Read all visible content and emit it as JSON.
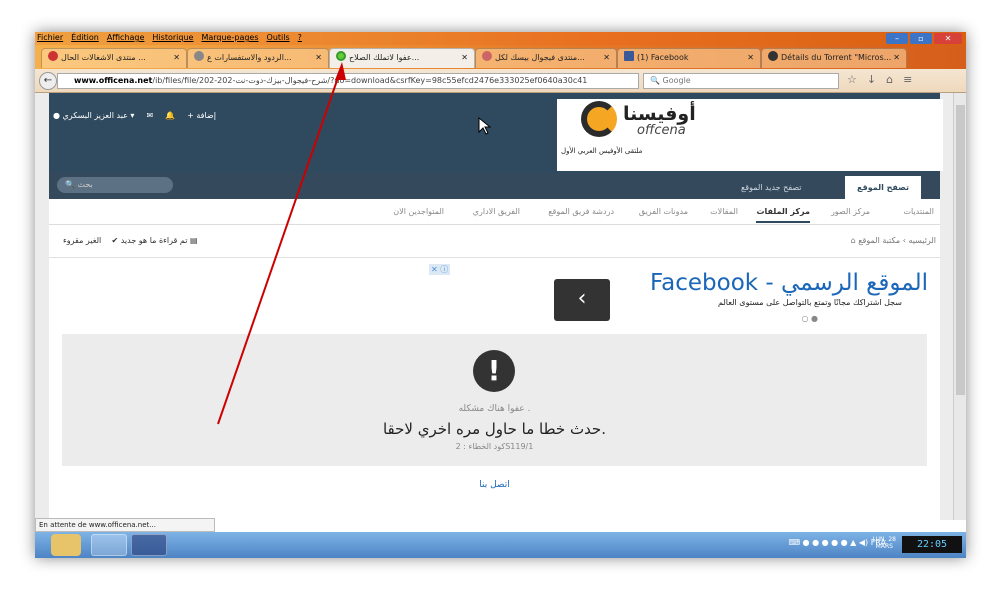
{
  "browser": {
    "menu": [
      "Fichier",
      "Édition",
      "Affichage",
      "Historique",
      "Marque-pages",
      "Outils",
      "?"
    ],
    "tabs": [
      {
        "label": "منتدى الاشغالات الحال ...",
        "active": false
      },
      {
        "label": "الردود والاستفسارات ع...",
        "active": false
      },
      {
        "label": "عفوا لاتملك الصلاح...",
        "active": true
      },
      {
        "label": "منتدى فيجوال بيسك لكل...",
        "active": false
      },
      {
        "label": "(1) Facebook",
        "active": false
      },
      {
        "label": "Détails du Torrent \"Micros...",
        "active": false
      }
    ],
    "url_host": "www.officena.net",
    "url_rest": "/ib/files/file/202-شرح-فيجوال-بيزك-دوت-نت-202/?do=download&csrfKey=98c55efcd2476e333025ef0640a30c41",
    "search_engine": "Google",
    "status": "En attente de www.officena.net..."
  },
  "site": {
    "logo_ar": "أوفيسنا",
    "logo_en": "offcena",
    "tagline": "ملتقى الأوفيس العربي الأول",
    "user_name": "عبد العزيز البسكري",
    "add_label": "+ إضافة",
    "search_placeholder": "بحث",
    "top_tabs": [
      "تصفح الموقع",
      "تصفح جديد الموقع"
    ],
    "sub_nav": [
      "المنتديات",
      "مركز الصور",
      "مركز الملفات",
      "المقالات",
      "مدونات الفريق",
      "دردشة فريق الموقع",
      "الفريق الاداري",
      "المتواجدين الان"
    ],
    "breadcrumb": "الرئيسيه › مكتبة الموقع",
    "unread": "الغير مقروء",
    "mark_read": "تم قراءة ما هو جديد"
  },
  "ad": {
    "title": "Facebook - الموقع الرسمي",
    "subtitle": "سجل اشتراكك مجانًا وتمتع بالتواصل على مستوى العالم",
    "mark": "✕ ⓘ",
    "arrow": "‹"
  },
  "error": {
    "line1": "عفوا هناك مشكله .",
    "line2": "حدث خطا ما حاول مره اخري لاحقا.",
    "code": "كود الخطاء : 2S119/1",
    "contact": "اتصل بنا"
  },
  "taskbar": {
    "lang": "FRA",
    "date_l1": "LUN. 28",
    "date_l2": "MARS",
    "time": "22:05"
  }
}
